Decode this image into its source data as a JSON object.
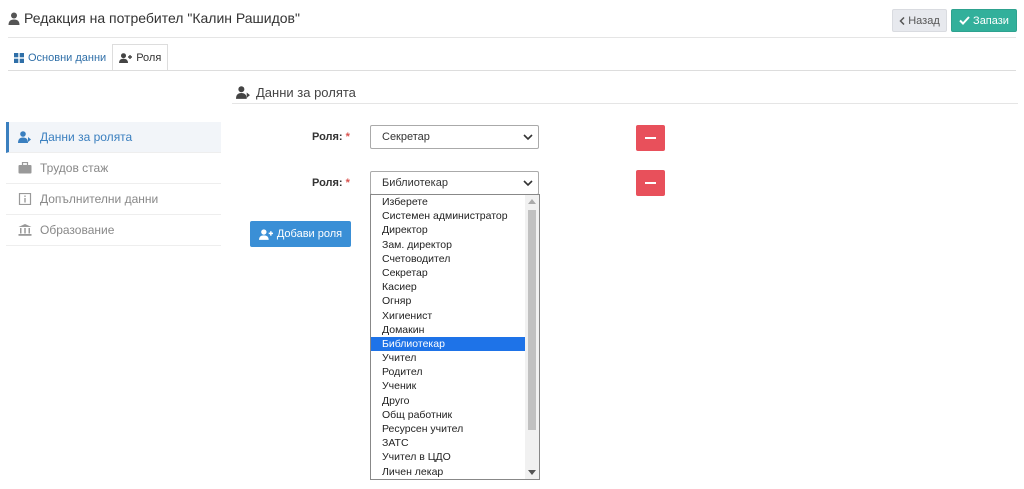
{
  "header": {
    "title": "Редакция на потребител \"Калин Рашидов\"",
    "back_label": "Назад",
    "save_label": "Запази"
  },
  "tabs": [
    {
      "label": "Основни данни",
      "icon": "grid-icon",
      "active": false
    },
    {
      "label": "Роля",
      "icon": "user-plus-icon",
      "active": true
    }
  ],
  "sidebar": {
    "items": [
      {
        "label": "Данни за ролята",
        "icon": "user-role-icon",
        "active": true
      },
      {
        "label": "Трудов стаж",
        "icon": "briefcase-icon",
        "active": false
      },
      {
        "label": "Допълнителни данни",
        "icon": "info-icon",
        "active": false
      },
      {
        "label": "Образование",
        "icon": "institution-icon",
        "active": false
      }
    ]
  },
  "section": {
    "title": "Данни за ролята"
  },
  "roles": [
    {
      "label": "Роля:",
      "required_mark": "*",
      "value": "Секретар"
    },
    {
      "label": "Роля:",
      "required_mark": "*",
      "value": "Библиотекар"
    }
  ],
  "add_role_label": "Добави роля",
  "dropdown": {
    "selected": "Библиотекар",
    "options": [
      "Изберете",
      "Системен администратор",
      "Директор",
      "Зам. директор",
      "Счетоводител",
      "Секретар",
      "Касиер",
      "Огняр",
      "Хигиенист",
      "Домакин",
      "Библиотекар",
      "Учител",
      "Родител",
      "Ученик",
      "Друго",
      "Общ работник",
      "Ресурсен учител",
      "ЗАТС",
      "Учител в ЦДО",
      "Личен лекар"
    ]
  },
  "colors": {
    "save": "#32b09b",
    "remove": "#e8505b",
    "add": "#3a8fd6",
    "active_link": "#3a7fbf",
    "selected_option": "#1e73e8"
  }
}
